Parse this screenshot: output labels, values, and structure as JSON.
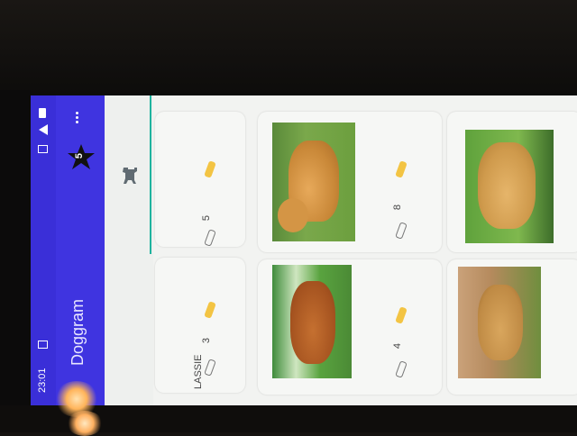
{
  "status_bar": {
    "time": "23:01"
  },
  "app_bar": {
    "title": "Doggram",
    "badge_count": "5",
    "overflow_icon": "more-vert-icon"
  },
  "tabs": [
    {
      "icon": "dog-icon",
      "active": true
    }
  ],
  "cards": [
    {
      "name": "LASSIE",
      "like_count": "3"
    },
    {
      "name": "",
      "like_count": "5"
    },
    {
      "name": "",
      "like_count": "4"
    },
    {
      "name": "",
      "like_count": "8"
    }
  ],
  "colors": {
    "primary": "#3f34e0",
    "accent": "#1fb39e",
    "like": "#f3c443"
  }
}
